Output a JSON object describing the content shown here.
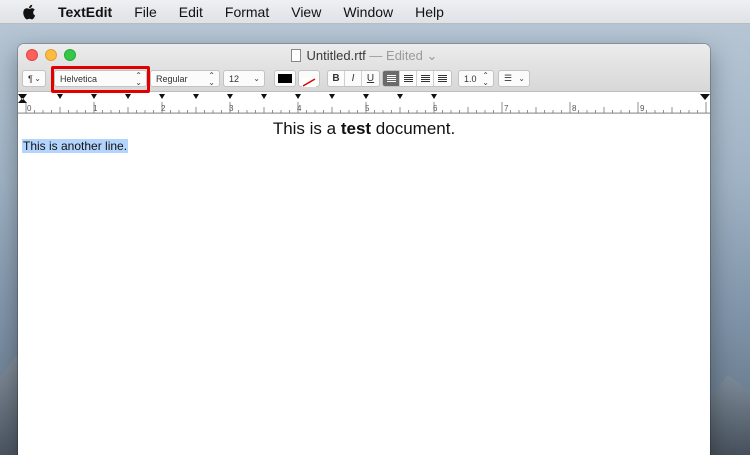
{
  "menubar": {
    "apple": "apple-icon",
    "items": [
      "TextEdit",
      "File",
      "Edit",
      "Format",
      "View",
      "Window",
      "Help"
    ]
  },
  "window": {
    "title": "Untitled.rtf",
    "edited": "— Edited",
    "edited_chevron": "⌄"
  },
  "toolbar": {
    "paragraph_style_icon": "¶",
    "font_family": "Helvetica",
    "font_style": "Regular",
    "font_size": "12",
    "bold": "B",
    "italic": "I",
    "underline": "U",
    "line_spacing": "1.0",
    "text_color": "#000000",
    "highlight_color_outline": "#e00000"
  },
  "ruler": {
    "numbers": [
      "0",
      "1",
      "2",
      "3",
      "4",
      "5",
      "6",
      "7",
      "8",
      "9"
    ]
  },
  "document": {
    "line1_before": "This is a ",
    "line1_bold": "test",
    "line1_after": " document.",
    "line2": "This is another line."
  },
  "colors": {
    "selection": "#b3d4fc",
    "close": "#fc605c",
    "minimize": "#fdbc40",
    "maximize": "#34c84a"
  }
}
